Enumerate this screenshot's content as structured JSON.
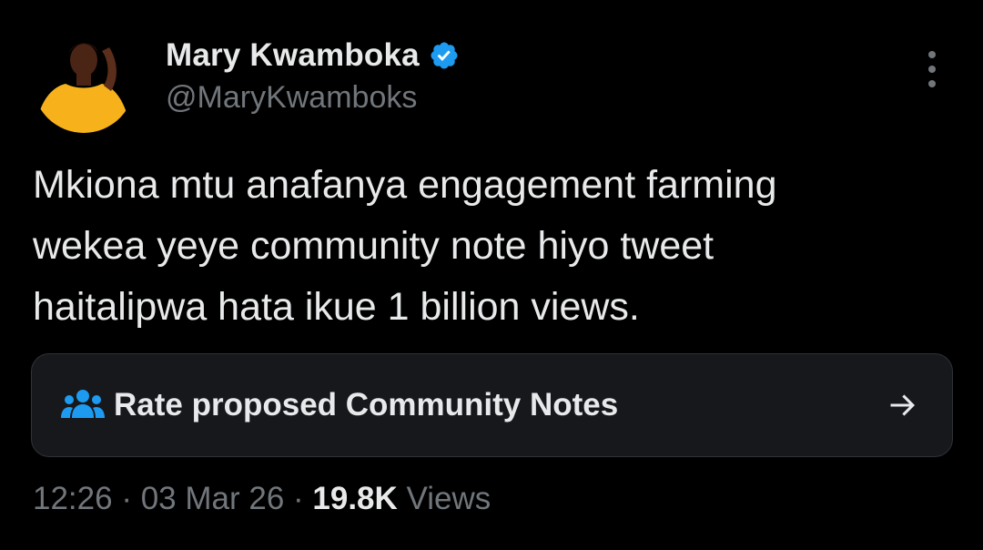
{
  "author": {
    "display_name": "Mary Kwamboka",
    "handle": "@MaryKwamboks",
    "verified": true
  },
  "tweet": {
    "text": "Mkiona mtu anafanya engagement farming\nwekea yeye community note hiyo tweet\nhaitalipwa hata ikue 1 billion views."
  },
  "community_notes": {
    "label": "Rate proposed Community Notes",
    "icon": "people-icon",
    "arrow_icon": "arrow-right-icon"
  },
  "meta": {
    "time": "12:26",
    "separator": " · ",
    "date": "03 Mar 26",
    "views_count": "19.8K",
    "views_label": " Views"
  },
  "colors": {
    "background": "#000000",
    "primary_text": "#e7e9ea",
    "secondary_text": "#71767b",
    "verified_blue": "#1d9bf0",
    "card_bg": "#16181c",
    "card_border": "#2f3336"
  }
}
